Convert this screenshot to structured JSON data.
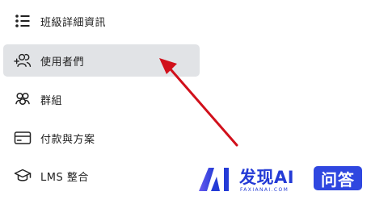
{
  "menu": {
    "items": [
      {
        "label": "班級詳細資訊",
        "icon": "list-bullets-icon",
        "active": false
      },
      {
        "label": "使用者們",
        "icon": "add-users-icon",
        "active": true
      },
      {
        "label": "群組",
        "icon": "group-icon",
        "active": false
      },
      {
        "label": "付款與方案",
        "icon": "credit-card-icon",
        "active": false
      },
      {
        "label": "LMS 整合",
        "icon": "graduation-cap-icon",
        "active": false
      }
    ]
  },
  "annotation": {
    "arrow_color": "#d1101b"
  },
  "watermark": {
    "brand": "发现AI",
    "domain": "FAXIANAI.COM",
    "badge": "问答",
    "brand_color": "#243bd6"
  }
}
